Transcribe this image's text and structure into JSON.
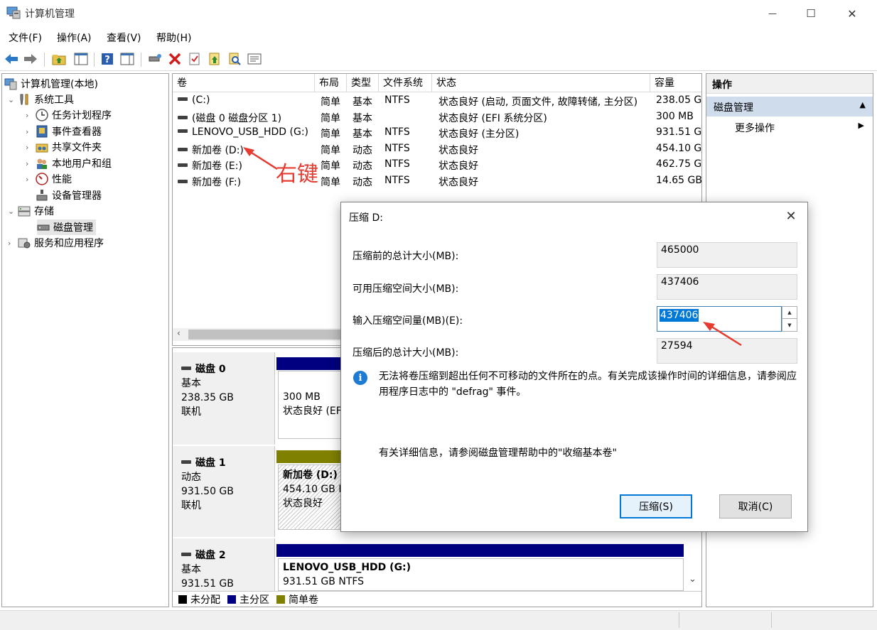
{
  "window": {
    "title": "计算机管理",
    "minimize_glyph": "—",
    "maximize_glyph": "☐",
    "close_glyph": "✕"
  },
  "menu": [
    "文件(F)",
    "操作(A)",
    "查看(V)",
    "帮助(H)"
  ],
  "toolbar_icons": [
    "back-arrow-icon",
    "forward-arrow-icon",
    "folder-up-icon",
    "show-hide-tree-icon",
    "help-icon",
    "properties-pane-icon",
    "connect-icon",
    "delete-icon",
    "check-icon",
    "import-icon",
    "find-icon",
    "list-icon"
  ],
  "tree": {
    "root": "计算机管理(本地)",
    "system_tools": "系统工具",
    "task_scheduler": "任务计划程序",
    "event_viewer": "事件查看器",
    "shared_folders": "共享文件夹",
    "local_users": "本地用户和组",
    "performance": "性能",
    "device_manager": "设备管理器",
    "storage": "存储",
    "disk_management": "磁盘管理",
    "services_apps": "服务和应用程序"
  },
  "volumes": {
    "headers": [
      "卷",
      "布局",
      "类型",
      "文件系统",
      "状态",
      "容量"
    ],
    "rows": [
      [
        "(C:)",
        "简单",
        "基本",
        "NTFS",
        "状态良好 (启动, 页面文件, 故障转储, 主分区)",
        "238.05 G"
      ],
      [
        "(磁盘 0 磁盘分区 1)",
        "简单",
        "基本",
        "",
        "状态良好 (EFI 系统分区)",
        "300 MB"
      ],
      [
        "LENOVO_USB_HDD (G:)",
        "简单",
        "基本",
        "NTFS",
        "状态良好 (主分区)",
        "931.51 G"
      ],
      [
        "新加卷 (D:)",
        "简单",
        "动态",
        "NTFS",
        "状态良好",
        "454.10 G"
      ],
      [
        "新加卷 (E:)",
        "简单",
        "动态",
        "NTFS",
        "状态良好",
        "462.75 G"
      ],
      [
        "新加卷 (F:)",
        "简单",
        "动态",
        "NTFS",
        "状态良好",
        "14.65 GB"
      ]
    ]
  },
  "annotation": "右键",
  "disks": [
    {
      "name": "磁盘 0",
      "type": "基本",
      "size": "238.35 GB",
      "status": "联机",
      "part_size": "300 MB",
      "part_status": "状态良好 (EF"
    },
    {
      "name": "磁盘 1",
      "type": "动态",
      "size": "931.50 GB",
      "status": "联机",
      "part_name": "新加卷 (D:)",
      "part_size": "454.10 GB N",
      "part_status": "状态良好"
    },
    {
      "name": "磁盘 2",
      "type": "基本",
      "size": "931.51 GB",
      "status": "",
      "part_name": "LENOVO_USB_HDD (G:)",
      "part_size": "931.51 GB NTFS"
    }
  ],
  "legend": [
    {
      "label": "未分配",
      "color": "#000000"
    },
    {
      "label": "主分区",
      "color": "#000080"
    },
    {
      "label": "简单卷",
      "color": "#808000"
    }
  ],
  "actions": {
    "header": "操作",
    "section": "磁盘管理",
    "more": "更多操作"
  },
  "dialog": {
    "title": "压缩 D:",
    "total_before_label": "压缩前的总计大小(MB):",
    "total_before_value": "465000",
    "available_label": "可用压缩空间大小(MB):",
    "available_value": "437406",
    "input_label": "输入压缩空间量(MB)(E):",
    "input_value": "437406",
    "total_after_label": "压缩后的总计大小(MB):",
    "total_after_value": "27594",
    "info_text": "无法将卷压缩到超出任何不可移动的文件所在的点。有关完成该操作时间的详细信息，请参阅应用程序日志中的 \"defrag\" 事件。",
    "more_info": "有关详细信息，请参阅磁盘管理帮助中的\"收缩基本卷\"",
    "shrink_button": "压缩(S)",
    "cancel_button": "取消(C)"
  },
  "colors": {
    "primary_partition": "#000080",
    "simple_volume": "#808000",
    "selection": "#0078d7",
    "annotation": "#e53b30",
    "action_section": "#cfdcec"
  }
}
